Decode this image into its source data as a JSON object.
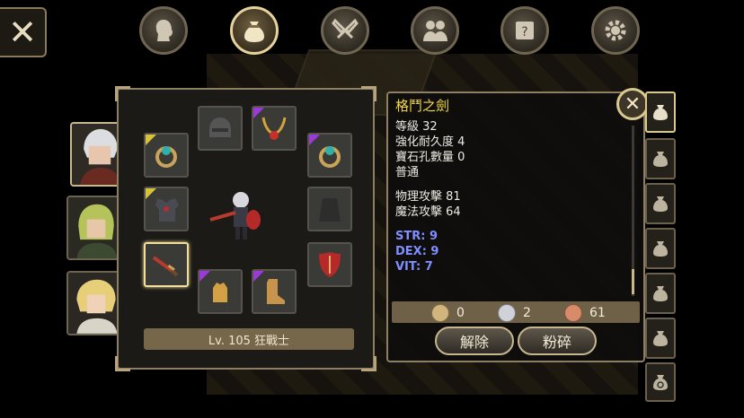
{
  "close_button": {
    "icon": "close-icon",
    "glyph": "✕"
  },
  "tabs": [
    {
      "icon": "profile-head-icon",
      "active": false
    },
    {
      "icon": "money-bag-icon",
      "active": true
    },
    {
      "icon": "crossed-swords-icon",
      "active": false
    },
    {
      "icon": "party-icon",
      "active": false
    },
    {
      "icon": "quest-scroll-icon",
      "active": false
    },
    {
      "icon": "gear-icon",
      "active": false
    }
  ],
  "characters": [
    {
      "icon": "silver-hair-warrior-portrait",
      "active": true
    },
    {
      "icon": "green-hair-portrait",
      "active": false
    },
    {
      "icon": "blonde-hair-portrait",
      "active": false
    }
  ],
  "equipment": {
    "level_text": "Lv. 105 狂戰士",
    "slots": [
      {
        "icon": "helmet-icon",
        "rarity": "empty"
      },
      {
        "icon": "necklace-icon",
        "rarity": "epic"
      },
      {
        "icon": "ring-icon",
        "rarity": "legendary"
      },
      {
        "icon": "ring-icon",
        "rarity": "epic"
      },
      {
        "icon": "armor-icon",
        "rarity": "legendary"
      },
      {
        "icon": "cape-icon",
        "rarity": "empty"
      },
      {
        "icon": "sword-icon",
        "rarity": "none",
        "selected": true
      },
      {
        "icon": "shield-icon",
        "rarity": "none"
      },
      {
        "icon": "gloves-icon",
        "rarity": "epic"
      },
      {
        "icon": "boots-icon",
        "rarity": "epic"
      }
    ],
    "rarity_colors": {
      "epic": "#9b3ad6",
      "legendary": "#d8c23a"
    }
  },
  "item_info": {
    "name": "格鬥之劍",
    "lines": [
      "等級 32",
      "強化耐久度 4",
      "寶石孔數量 0",
      "普通"
    ],
    "attack_lines": [
      "物理攻擊 81",
      "魔法攻擊 64"
    ],
    "stats": [
      "STR: 9",
      "DEX: 9",
      "VIT: 7"
    ],
    "close_icon": "close-icon",
    "close_glyph": "✕"
  },
  "currency": {
    "gold": "0",
    "silver": "2",
    "copper": "61"
  },
  "actions": {
    "unequip": "解除",
    "smash": "粉碎"
  },
  "bag_tabs": [
    {
      "icon": "bag-icon"
    },
    {
      "icon": "bag-icon"
    },
    {
      "icon": "bag-icon"
    },
    {
      "icon": "bag-icon"
    },
    {
      "icon": "bag-icon"
    },
    {
      "icon": "bag-icon"
    },
    {
      "icon": "bag-search-icon"
    }
  ]
}
